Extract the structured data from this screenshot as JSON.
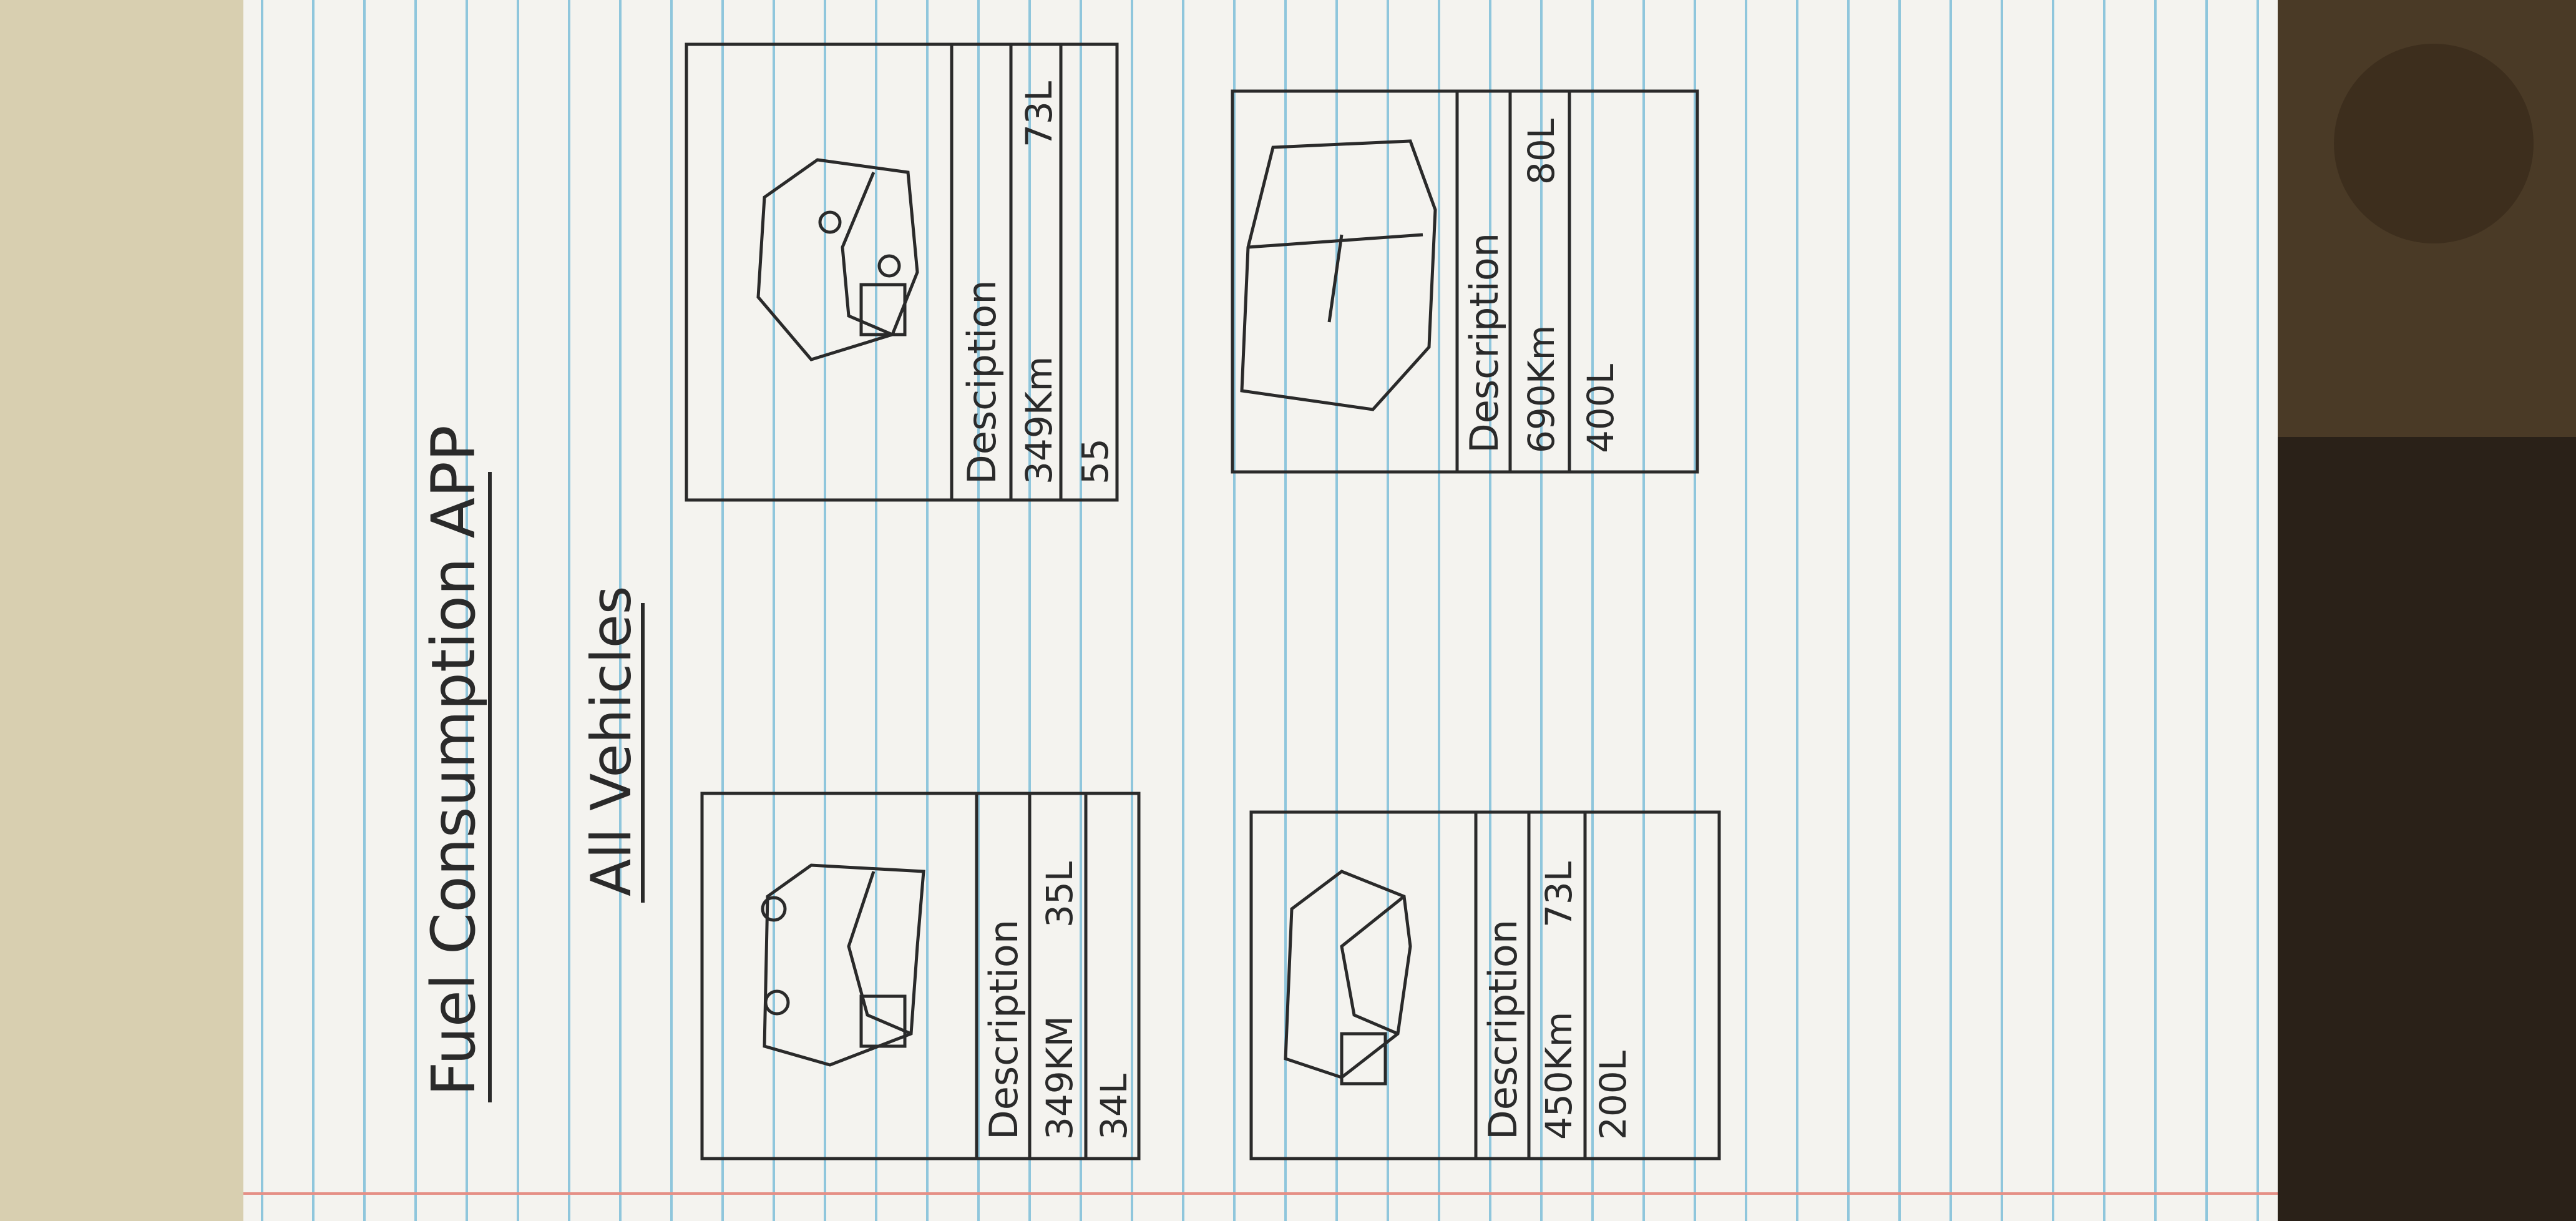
{
  "sketch": {
    "app_title": "Fuel Consumption APP",
    "section_title": "All Vehicles",
    "cards": [
      {
        "label": "Description",
        "distance": "349KM",
        "fuel_a": "35L",
        "fuel_b": "34L"
      },
      {
        "label": "Description",
        "distance": "450Km",
        "fuel_a": "73L",
        "fuel_b": "200L"
      },
      {
        "label": "Desciption",
        "distance": "349Km",
        "fuel_a": "73L",
        "fuel_b": "55"
      },
      {
        "label": "Description",
        "distance": "690Km",
        "fuel_a": "80L",
        "fuel_b": "400L"
      }
    ]
  },
  "colors": {
    "table": "#d8cfb0",
    "paper": "#f4f3ef",
    "rule_line": "#8fc6dc",
    "margin_line": "#e58f86",
    "ink": "#2a2a2a",
    "dark_corner": "#2a2118"
  }
}
